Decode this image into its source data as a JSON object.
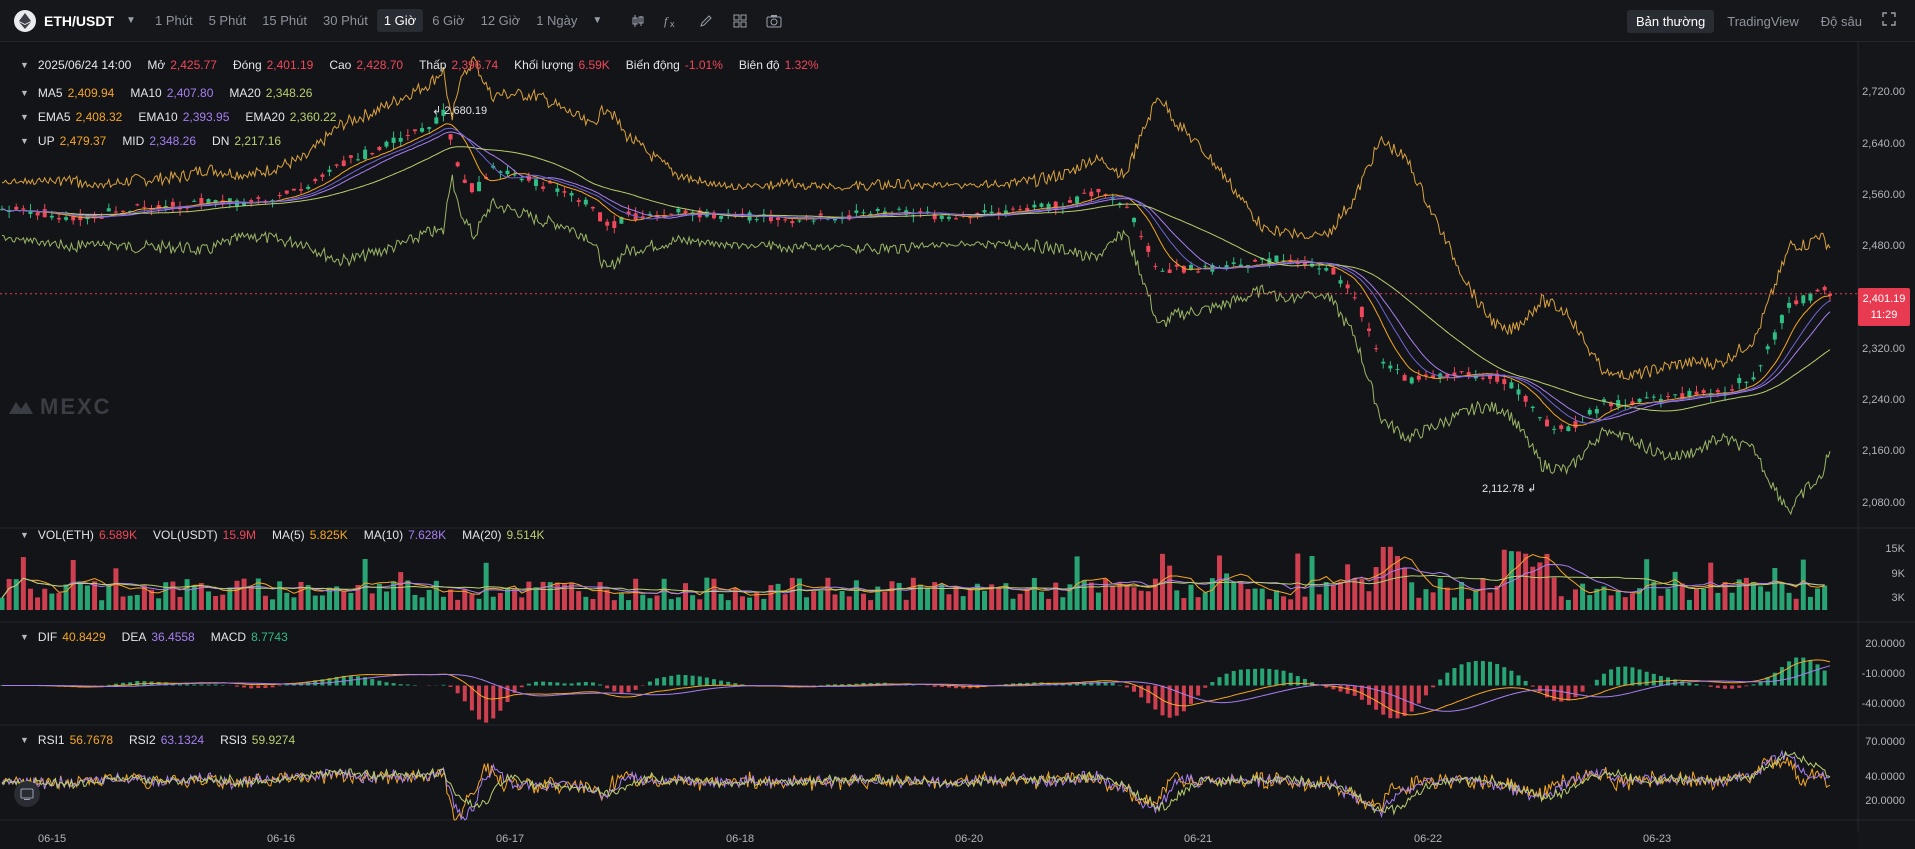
{
  "toolbar": {
    "symbol": "ETH/USDT",
    "intervals": [
      "1 Phút",
      "5 Phút",
      "15 Phút",
      "30 Phút",
      "1 Giờ",
      "6 Giờ",
      "12 Giờ",
      "1 Ngày"
    ],
    "active_interval": "1 Giờ",
    "view_modes": [
      "Bản thường",
      "TradingView",
      "Độ sâu"
    ],
    "active_view": "Bản thường",
    "tool_icons": [
      "candles-settings-icon",
      "indicators-fx-icon",
      "draw-pencil-icon",
      "layout-grid-icon",
      "camera-icon"
    ]
  },
  "ohlc": {
    "date": "2025/06/24 14:00",
    "open_label": "Mở",
    "open": "2,425.77",
    "close_label": "Đóng",
    "close": "2,401.19",
    "high_label": "Cao",
    "high": "2,428.70",
    "low_label": "Thấp",
    "low": "2,396.74",
    "volume_label": "Khối lượng",
    "volume": "6.59K",
    "change_label": "Biến động",
    "change": "-1.01%",
    "amplitude_label": "Biên độ",
    "amplitude": "1.32%"
  },
  "ma": {
    "ma5_label": "MA5",
    "ma5": "2,409.94",
    "ma10_label": "MA10",
    "ma10": "2,407.80",
    "ma20_label": "MA20",
    "ma20": "2,348.26"
  },
  "ema": {
    "ema5_label": "EMA5",
    "ema5": "2,408.32",
    "ema10_label": "EMA10",
    "ema10": "2,393.95",
    "ema20_label": "EMA20",
    "ema20": "2,360.22"
  },
  "boll": {
    "up_label": "UP",
    "up": "2,479.37",
    "mid_label": "MID",
    "mid": "2,348.26",
    "dn_label": "DN",
    "dn": "2,217.16"
  },
  "vol": {
    "eth_label": "VOL(ETH)",
    "eth": "6.589K",
    "usdt_label": "VOL(USDT)",
    "usdt": "15.9M",
    "ma5_label": "MA(5)",
    "ma5": "5.825K",
    "ma10_label": "MA(10)",
    "ma10": "7.628K",
    "ma20_label": "MA(20)",
    "ma20": "9.514K"
  },
  "macd": {
    "dif_label": "DIF",
    "dif": "40.8429",
    "dea_label": "DEA",
    "dea": "36.4558",
    "macd_label": "MACD",
    "macd": "8.7743"
  },
  "rsi": {
    "rsi1_label": "RSI1",
    "rsi1": "56.7678",
    "rsi2_label": "RSI2",
    "rsi2": "63.1324",
    "rsi3_label": "RSI3",
    "rsi3": "59.9274"
  },
  "annotations": {
    "high": "2,680.19",
    "low": "2,112.78"
  },
  "last_price": {
    "price": "2,401.19",
    "countdown": "11:29"
  },
  "watermark": "MEXC",
  "colors": {
    "up": "#2ebd85",
    "down": "#f0475a",
    "ma5": "#f5a623",
    "ma10": "#a77ff2",
    "ma20": "#b8cf6f",
    "background": "#131417"
  },
  "chart_data": {
    "type": "candlestick",
    "price_axis": {
      "ticks": [
        "2,720.00",
        "2,640.00",
        "2,560.00",
        "2,480.00",
        "2,320.00",
        "2,240.00",
        "2,160.00",
        "2,080.00"
      ],
      "range": [
        2060,
        2760
      ]
    },
    "volume_axis": {
      "ticks": [
        "15K",
        "9K",
        "3K"
      ]
    },
    "macd_axis": {
      "ticks": [
        "20.0000",
        "-10.0000",
        "-40.0000"
      ]
    },
    "rsi_axis": {
      "ticks": [
        "70.0000",
        "40.0000",
        "20.0000"
      ]
    },
    "x_ticks": [
      "06-15",
      "06-16",
      "06-17",
      "06-18",
      "06-20",
      "06-21",
      "06-22",
      "06-23"
    ],
    "close_keypoints": [
      [
        0,
        2530
      ],
      [
        20,
        2525
      ],
      [
        40,
        2515
      ],
      [
        70,
        2530
      ],
      [
        100,
        2535
      ],
      [
        115,
        2545
      ],
      [
        140,
        2540
      ],
      [
        170,
        2560
      ],
      [
        190,
        2600
      ],
      [
        210,
        2620
      ],
      [
        225,
        2640
      ],
      [
        240,
        2660
      ],
      [
        248,
        2678
      ],
      [
        255,
        2595
      ],
      [
        265,
        2555
      ],
      [
        275,
        2590
      ],
      [
        290,
        2580
      ],
      [
        300,
        2570
      ],
      [
        315,
        2560
      ],
      [
        330,
        2540
      ],
      [
        340,
        2500
      ],
      [
        350,
        2520
      ],
      [
        380,
        2525
      ],
      [
        410,
        2520
      ],
      [
        440,
        2515
      ],
      [
        470,
        2520
      ],
      [
        500,
        2525
      ],
      [
        530,
        2520
      ],
      [
        560,
        2525
      ],
      [
        580,
        2530
      ],
      [
        600,
        2540
      ],
      [
        610,
        2555
      ],
      [
        620,
        2555
      ],
      [
        630,
        2540
      ],
      [
        640,
        2490
      ],
      [
        650,
        2430
      ],
      [
        660,
        2440
      ],
      [
        680,
        2440
      ],
      [
        700,
        2445
      ],
      [
        720,
        2455
      ],
      [
        745,
        2440
      ],
      [
        760,
        2395
      ],
      [
        775,
        2300
      ],
      [
        790,
        2270
      ],
      [
        810,
        2275
      ],
      [
        830,
        2280
      ],
      [
        845,
        2270
      ],
      [
        855,
        2240
      ],
      [
        865,
        2205
      ],
      [
        880,
        2195
      ],
      [
        890,
        2215
      ],
      [
        900,
        2235
      ],
      [
        920,
        2235
      ],
      [
        940,
        2245
      ],
      [
        955,
        2250
      ],
      [
        965,
        2250
      ],
      [
        975,
        2265
      ],
      [
        985,
        2280
      ],
      [
        995,
        2335
      ],
      [
        1005,
        2390
      ],
      [
        1015,
        2395
      ],
      [
        1020,
        2410
      ],
      [
        1027,
        2400
      ]
    ],
    "bars": 1028
  }
}
